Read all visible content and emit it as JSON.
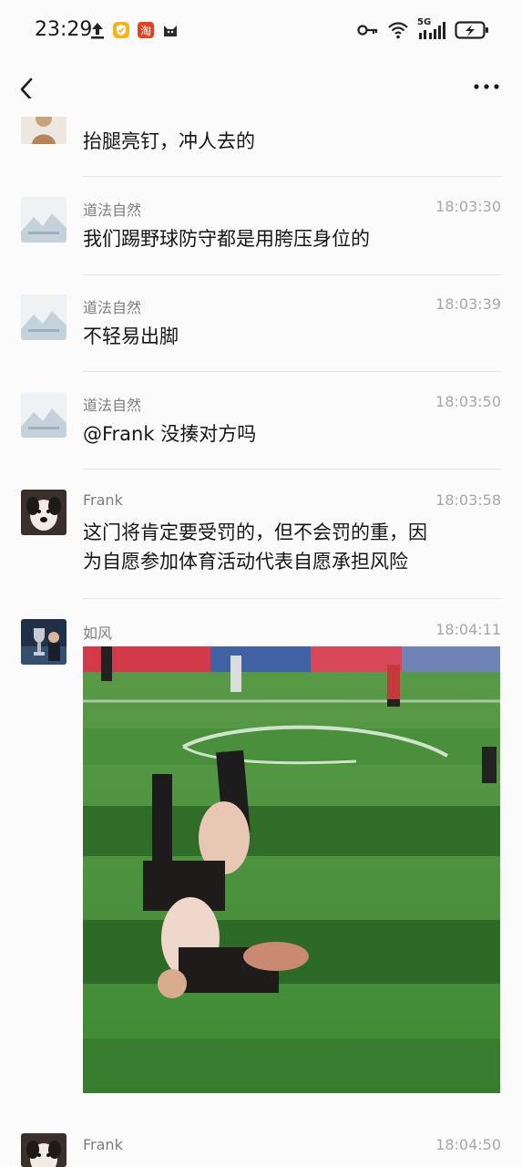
{
  "status_bar": {
    "time": "23:29",
    "icons_left": [
      "upload-icon",
      "shield-app-icon",
      "taobao-app-icon",
      "cat-app-icon"
    ],
    "network": "5G",
    "icons_right": [
      "key-icon",
      "wifi-icon",
      "signal-icon",
      "battery-icon"
    ]
  },
  "nav": {
    "back": "back-arrow-icon",
    "more": "more-dots-icon"
  },
  "messages": [
    {
      "sender": "",
      "time": "",
      "text": "抬腿亮钉，冲人去的"
    },
    {
      "sender": "道法自然",
      "time": "18:03:30",
      "text": "我们踢野球防守都是用胯压身位的"
    },
    {
      "sender": "道法自然",
      "time": "18:03:39",
      "text": "不轻易出脚"
    },
    {
      "sender": "道法自然",
      "time": "18:03:50",
      "text": "@Frank 没揍对方吗"
    },
    {
      "sender": "Frank",
      "time": "18:03:58",
      "text_line1": "这门将肯定要受罚的，但不会罚的重，因",
      "text_line2": "为自愿参加体育活动代表自愿承担风险"
    },
    {
      "sender": "如风",
      "time": "18:04:11",
      "image": "football-match-photo"
    },
    {
      "sender": "Frank",
      "time": "18:04:50"
    }
  ],
  "colors": {
    "background": "#fbfbfb",
    "pitch_light": "#4e9a3c",
    "pitch_dark": "#2f6d29",
    "banner": "#d23a4a"
  }
}
